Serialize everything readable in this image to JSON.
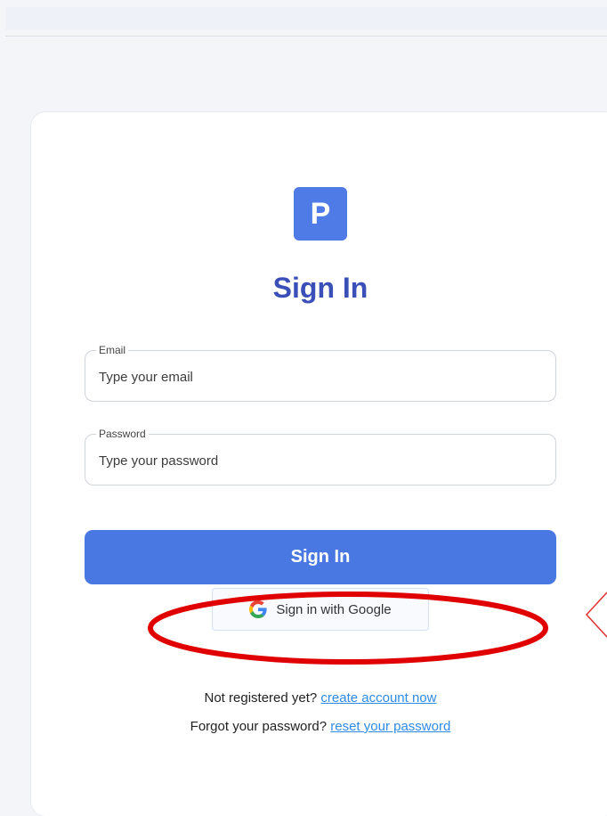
{
  "form": {
    "logo_letter": "P",
    "title": "Sign In",
    "email": {
      "label": "Email",
      "placeholder": "Type your email",
      "value": ""
    },
    "password": {
      "label": "Password",
      "placeholder": "Type your password",
      "value": ""
    },
    "signin_label": "Sign In",
    "google_label": "Sign in with Google",
    "register": {
      "prompt": "Not registered yet?",
      "link": "create account now"
    },
    "forgot": {
      "prompt": "Forgot your password?",
      "link": "reset your password"
    }
  },
  "icons": {
    "google": "google-g-icon"
  },
  "colors": {
    "brand": "#4f7be6",
    "title": "#3a4fb8",
    "link": "#2f8be6",
    "annotation": "#e00000"
  }
}
